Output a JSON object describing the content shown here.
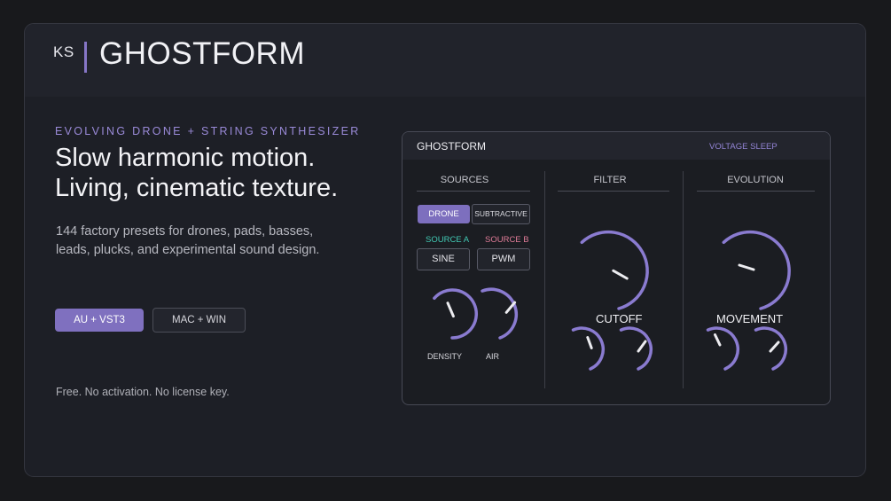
{
  "header": {
    "logo": "KS",
    "title": "GHOSTFORM"
  },
  "hero": {
    "tagline": "EVOLVING DRONE + STRING SYNTHESIZER",
    "headline_line1": "Slow harmonic motion.",
    "headline_line2": "Living, cinematic texture.",
    "description": "144 factory presets for drones, pads, basses, leads, plucks, and experimental sound design.",
    "formats_button": "AU + VST3",
    "platforms_button": "MAC + WIN",
    "footnote": "Free. No activation. No license key."
  },
  "plugin": {
    "title": "GHOSTFORM",
    "vendor": "VOLTAGE SLEEP",
    "sections": {
      "sources": "SOURCES",
      "filter": "FILTER",
      "evolution": "EVOLUTION"
    },
    "mode_buttons": [
      "DRONE",
      "SUBTRACTIVE"
    ],
    "active_mode": "DRONE",
    "source_a_label": "SOURCE A",
    "source_b_label": "SOURCE B",
    "source_a_wave": "SINE",
    "source_b_wave": "PWM",
    "knob_labels": {
      "density": "DENSITY",
      "air": "AIR",
      "cutoff": "CUTOFF",
      "movement": "MOVEMENT"
    }
  },
  "colors": {
    "accent": "#7f70bf",
    "source_a": "#41c9b4",
    "source_b": "#e07c98",
    "knob_arc": "#8a7bd0",
    "background": "#18191c",
    "card": "#1d1f26"
  }
}
